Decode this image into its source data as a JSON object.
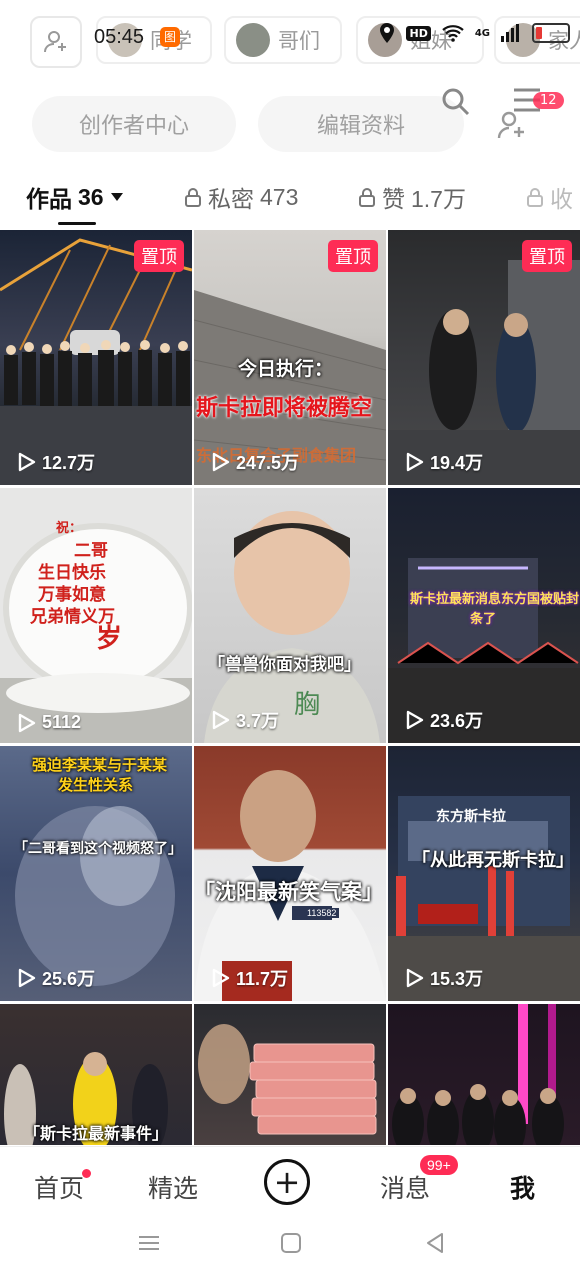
{
  "status_bar": {
    "time": "05:45",
    "notification_badge": "图",
    "icons": [
      "location-icon",
      "hd-icon",
      "wifi-icon",
      "4g-icon",
      "signal-icon",
      "battery-icon"
    ],
    "hd_label": "HD",
    "network_label": "4G",
    "battery_level": 0.15
  },
  "friends_strip": {
    "chips": [
      {
        "label": "同学"
      },
      {
        "label": "哥们"
      },
      {
        "label": "姐妹"
      },
      {
        "label": "家人"
      }
    ]
  },
  "profile_actions": {
    "creator_center": "创作者中心",
    "edit_profile": "编辑资料",
    "menu_badge": "12"
  },
  "tabs": [
    {
      "label": "作品",
      "count": "36",
      "locked": false,
      "active": true
    },
    {
      "label": "私密",
      "count": "473",
      "locked": true,
      "active": false
    },
    {
      "label": "赞",
      "count": "1.7万",
      "locked": true,
      "active": false
    },
    {
      "label": "收",
      "count": "",
      "locked": true,
      "active": false
    }
  ],
  "pinned_label": "置顶",
  "videos": [
    {
      "views": "12.7万",
      "pinned": true,
      "caption": ""
    },
    {
      "views": "247.5万",
      "pinned": true,
      "caption_top": "今日执行：",
      "caption_main": "斯卡拉即将被腾空",
      "caption_bottom": "东北日复合子副食集团"
    },
    {
      "views": "19.4万",
      "pinned": true,
      "caption": ""
    },
    {
      "views": "5112",
      "pinned": false,
      "cake_lines": [
        "祝：",
        "二哥",
        "生日快乐",
        "万事如意",
        "兄弟情义万",
        "岁"
      ]
    },
    {
      "views": "3.7万",
      "pinned": false,
      "caption": "「兽兽你面对我吧」"
    },
    {
      "views": "23.6万",
      "pinned": false,
      "caption_main": "斯卡拉最新消息东方国被贴封",
      "caption_bottom": "条了"
    },
    {
      "views": "25.6万",
      "pinned": false,
      "caption_top": "强迫李某某与于某某",
      "caption_top2": "发生性关系",
      "caption_main": "「二哥看到这个视频怒了」"
    },
    {
      "views": "11.7万",
      "pinned": false,
      "caption": "「沈阳最新笑气案」",
      "badge_no": "113582"
    },
    {
      "views": "15.3万",
      "pinned": false,
      "caption": "「从此再无斯卡拉」",
      "sign": "东方斯卡拉"
    },
    {
      "views": "",
      "pinned": false,
      "caption": "「斯卡拉最新事件」"
    },
    {
      "views": "",
      "pinned": false,
      "caption": ""
    },
    {
      "views": "",
      "pinned": false,
      "caption": ""
    }
  ],
  "bottom_nav": {
    "home": "首页",
    "featured": "精选",
    "create": "+",
    "messages": "消息",
    "messages_badge": "99+",
    "me": "我"
  },
  "colors": {
    "accent": "#fe2c55",
    "text_primary": "#111111",
    "text_secondary": "#666666"
  }
}
